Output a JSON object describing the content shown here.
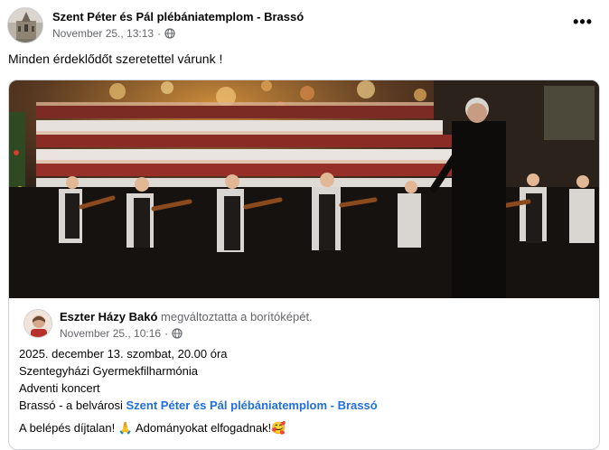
{
  "post": {
    "page_name": "Szent Péter és Pál plébániatemplom - Brassó",
    "timestamp": "November 25., 13:13",
    "separator": "·",
    "privacy_icon": "globe-icon",
    "more_icon": "more-options-icon",
    "more_label": "•••",
    "text": "Minden érdeklődőt szeretettel várunk !"
  },
  "shared": {
    "author_name": "Eszter Házy Bakó",
    "action": "megváltoztatta a borítóképét.",
    "timestamp": "November 25., 10:16",
    "separator": "·",
    "privacy_icon": "globe-icon",
    "line1": "2025. december 13. szombat, 20.00 óra",
    "line2": "Szentegyházi Gyermekfilharmónia",
    "line3": "Adventi koncert",
    "line4_prefix": "Brassó - a belvárosi",
    "line4_link": "Szent Péter és Pál plébániatemplom - Brassó",
    "line5_part1": "A belépés díjtalan!",
    "line5_emoji1": "🙏",
    "line5_part2": "Adományokat elfogadnak!",
    "line5_emoji2": "🥰"
  },
  "colors": {
    "link": "#216fdb",
    "secondary_text": "#65676b",
    "border": "#ced0d4"
  }
}
